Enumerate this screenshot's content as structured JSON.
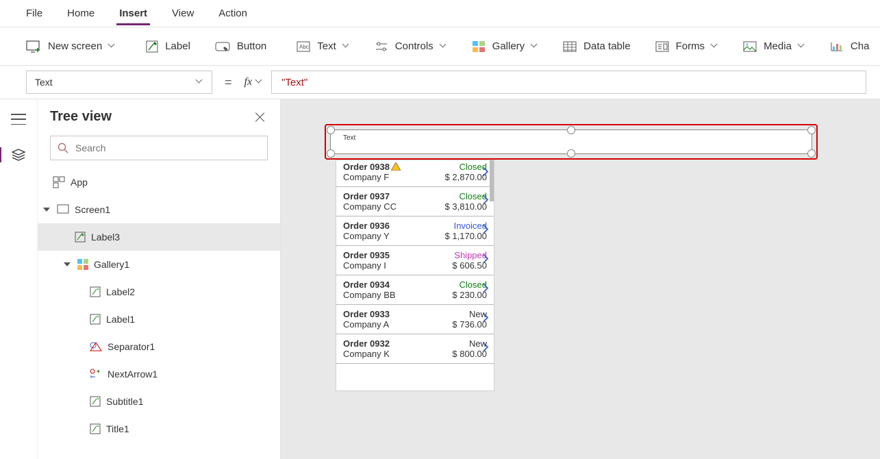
{
  "menu": {
    "tabs": [
      "File",
      "Home",
      "Insert",
      "View",
      "Action"
    ],
    "active": "Insert"
  },
  "ribbon": {
    "new_screen": "New screen",
    "label": "Label",
    "button": "Button",
    "text": "Text",
    "controls": "Controls",
    "gallery": "Gallery",
    "data_table": "Data table",
    "forms": "Forms",
    "media": "Media",
    "charts": "Cha"
  },
  "formula": {
    "property": "Text",
    "value": "\"Text\""
  },
  "tree": {
    "title": "Tree view",
    "search_placeholder": "Search",
    "app": "App",
    "screen": "Screen1",
    "selected": "Label3",
    "gallery": "Gallery1",
    "children": [
      "Label2",
      "Label1",
      "Separator1",
      "NextArrow1",
      "Subtitle1",
      "Title1"
    ]
  },
  "canvas": {
    "label_text": "Text"
  },
  "gallery": {
    "rows": [
      {
        "order": "Order 0938",
        "company": "Company F",
        "status": "Closed",
        "amount": "$ 2,870.00",
        "warn": true
      },
      {
        "order": "Order 0937",
        "company": "Company CC",
        "status": "Closed",
        "amount": "$ 3,810.00"
      },
      {
        "order": "Order 0936",
        "company": "Company Y",
        "status": "Invoiced",
        "amount": "$ 1,170.00"
      },
      {
        "order": "Order 0935",
        "company": "Company I",
        "status": "Shipped",
        "amount": "$ 606.50"
      },
      {
        "order": "Order 0934",
        "company": "Company BB",
        "status": "Closed",
        "amount": "$ 230.00"
      },
      {
        "order": "Order 0933",
        "company": "Company A",
        "status": "New",
        "amount": "$ 736.00"
      },
      {
        "order": "Order 0932",
        "company": "Company K",
        "status": "New",
        "amount": "$ 800.00"
      }
    ]
  }
}
